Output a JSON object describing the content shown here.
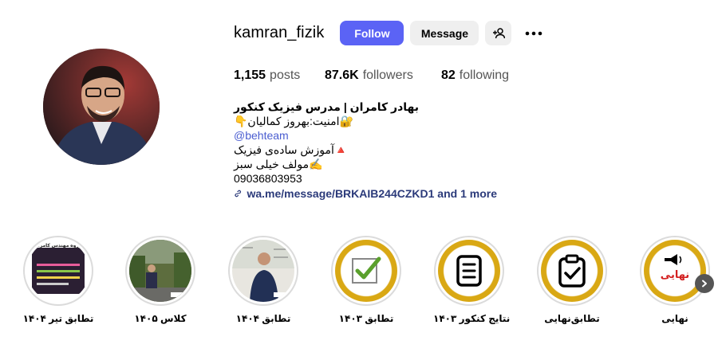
{
  "profile": {
    "username": "kamran_fizik",
    "follow_label": "Follow",
    "message_label": "Message",
    "stats": {
      "posts_count": "1,155",
      "posts_label": "posts",
      "followers_count": "87.6K",
      "followers_label": "followers",
      "following_count": "82",
      "following_label": "following"
    },
    "bio": {
      "name": "بهادر کامران | مدرس فیزیک کنکور",
      "line1": "🔐امنیت:بهروز کمالیان👇",
      "mention": "@behteam",
      "line2": "🔺آموزش ساده‌ی فیزیک",
      "line3": "✍️مولف خیلی سبز",
      "phone": "09036803953",
      "link": "wa.me/message/BRKAIB244CZKD1 and 1 more"
    }
  },
  "highlights": [
    {
      "label": "تطابق تیر ۱۴۰۴",
      "thumb": "document-thumbnail",
      "thumb_text": "جزوه مهندس کامران"
    },
    {
      "label": "کلاس ۱۴۰۵",
      "thumb": "classroom-photo"
    },
    {
      "label": "تطابق ۱۴۰۴",
      "thumb": "teacher-whiteboard-photo"
    },
    {
      "label": "تطابق ۱۴۰۳",
      "thumb": "check-icon"
    },
    {
      "label": "نتایج کنکور ۱۴۰۳",
      "thumb": "document-icon"
    },
    {
      "label": "تطابق‌نهایی",
      "thumb": "clipboard-check-icon"
    },
    {
      "label": "نهایی",
      "thumb": "megaphone-icon",
      "thumb_text": "نهایی"
    }
  ],
  "colors": {
    "follow_button": "#5b63f5",
    "gold": "#d9a814",
    "link": "#2b3a7a",
    "mention": "#4a5dd0"
  }
}
